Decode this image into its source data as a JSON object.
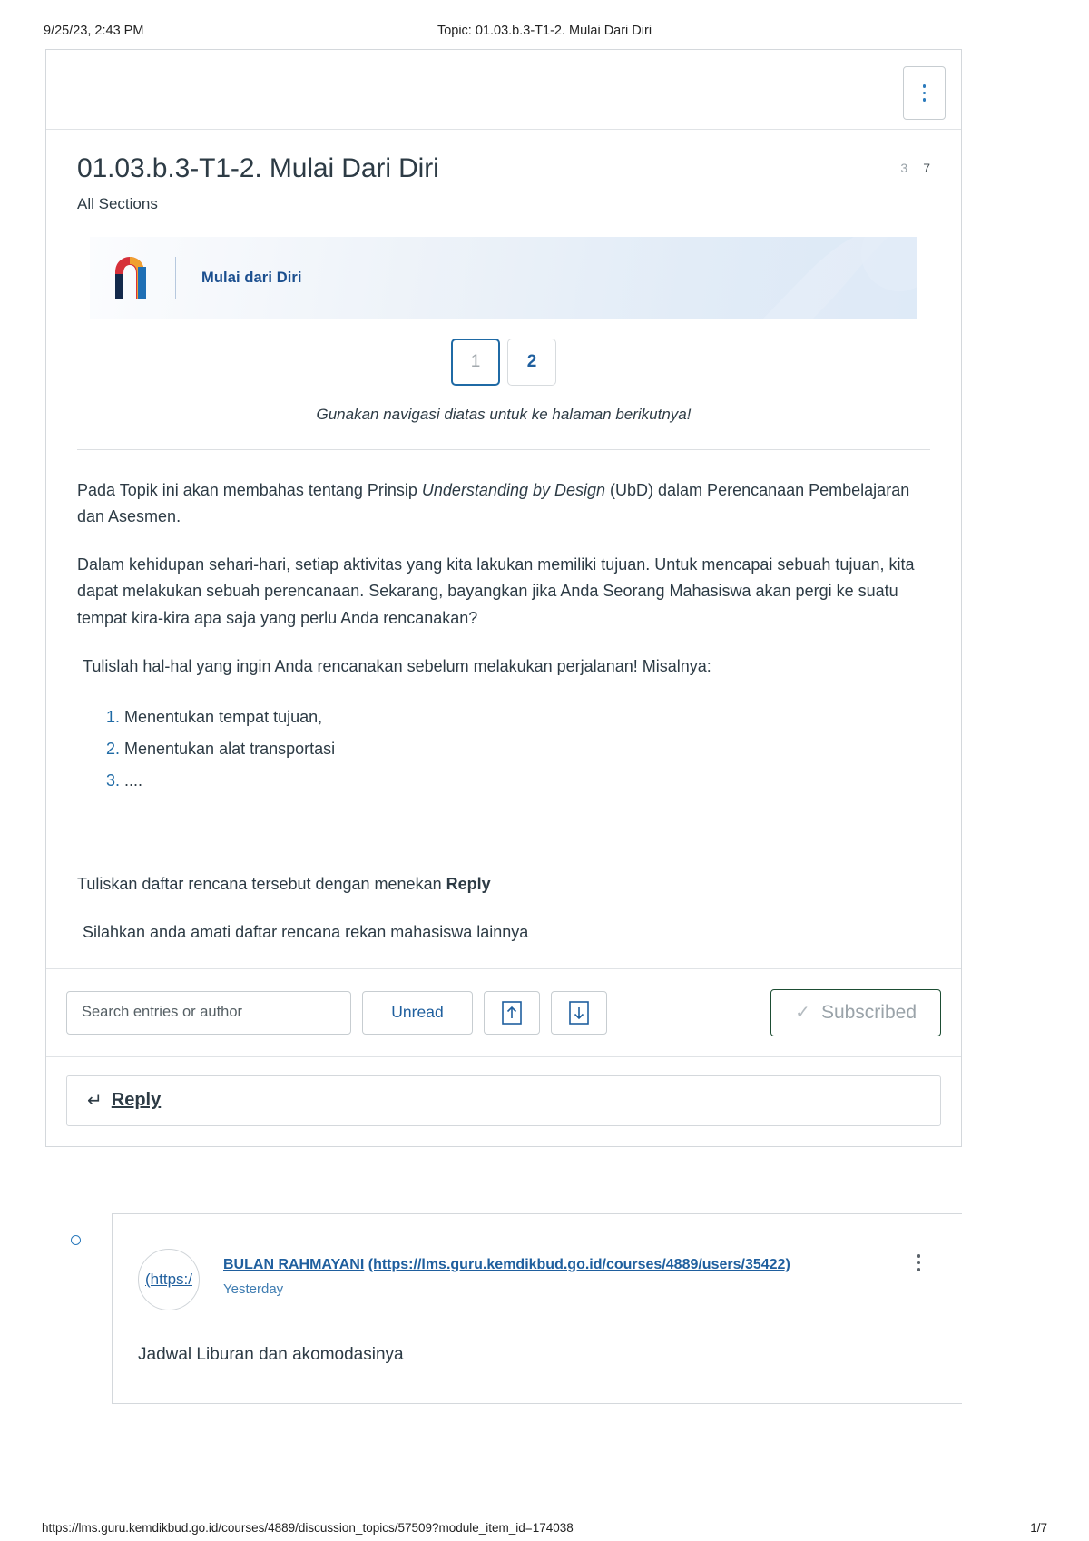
{
  "print": {
    "date": "9/25/23, 2:43 PM",
    "header_title": "Topic: 01.03.b.3-T1-2. Mulai Dari Diri",
    "footer_url": "https://lms.guru.kemdikbud.go.id/courses/4889/discussion_topics/57509?module_item_id=174038",
    "page_number": "1/7"
  },
  "topic": {
    "title": "01.03.b.3-T1-2. Mulai Dari Diri",
    "sections": "All Sections",
    "unread_count": "3",
    "total_count": "7",
    "kebab_label": "options-menu"
  },
  "banner": {
    "label": "Mulai dari Diri",
    "logo_colors": {
      "red": "#d6303a",
      "orange": "#f0a030",
      "blue": "#1f6fb5",
      "navy": "#13294b"
    }
  },
  "pagination": {
    "pages": [
      {
        "label": "1",
        "current": true
      },
      {
        "label": "2",
        "current": false
      }
    ],
    "caption": "Gunakan navigasi diatas untuk ke halaman berikutnya!"
  },
  "content": {
    "p1_before": "Pada Topik ini akan membahas tentang Prinsip ",
    "p1_italic": "Understanding by Design",
    "p1_after": " (UbD) dalam Perencanaan Pembelajaran dan Asesmen.",
    "p2": "Dalam kehidupan sehari-hari, setiap aktivitas yang kita lakukan memiliki tujuan. Untuk mencapai sebuah tujuan, kita dapat melakukan sebuah perencanaan. Sekarang, bayangkan jika Anda Seorang Mahasiswa akan pergi ke suatu tempat kira-kira apa saja yang perlu Anda rencanakan?",
    "p3": "Tulislah hal-hal yang ingin Anda rencanakan sebelum melakukan perjalanan!  Misalnya:",
    "list": [
      "Menentukan  tempat tujuan,",
      "Menentukan alat transportasi",
      "...."
    ],
    "p4_before": "Tuliskan daftar rencana tersebut dengan menekan ",
    "p4_bold": "Reply",
    "p5": "Silahkan anda amati daftar rencana rekan mahasiswa lainnya"
  },
  "toolbar": {
    "search_placeholder": "Search entries or author",
    "search_value": "",
    "unread_label": "Unread",
    "sort_up_icon": "arrow-up-in-box-icon",
    "sort_down_icon": "arrow-down-in-box-icon",
    "subscribed_label": "Subscribed",
    "subscribed_check": "✓",
    "subscribed_border_color": "#1d4d33"
  },
  "reply_bar": {
    "arrow": "↵",
    "label": "Reply"
  },
  "entry": {
    "avatar_text": "(https:/",
    "author_name": "BULAN RAHMAYANI",
    "author_url": "(https://lms.guru.kemdikbud.go.id/courses/4889/users/35422)",
    "timestamp": "Yesterday",
    "body": "Jadwal Liburan dan akomodasinya",
    "kebab_label": "entry-options-menu"
  }
}
